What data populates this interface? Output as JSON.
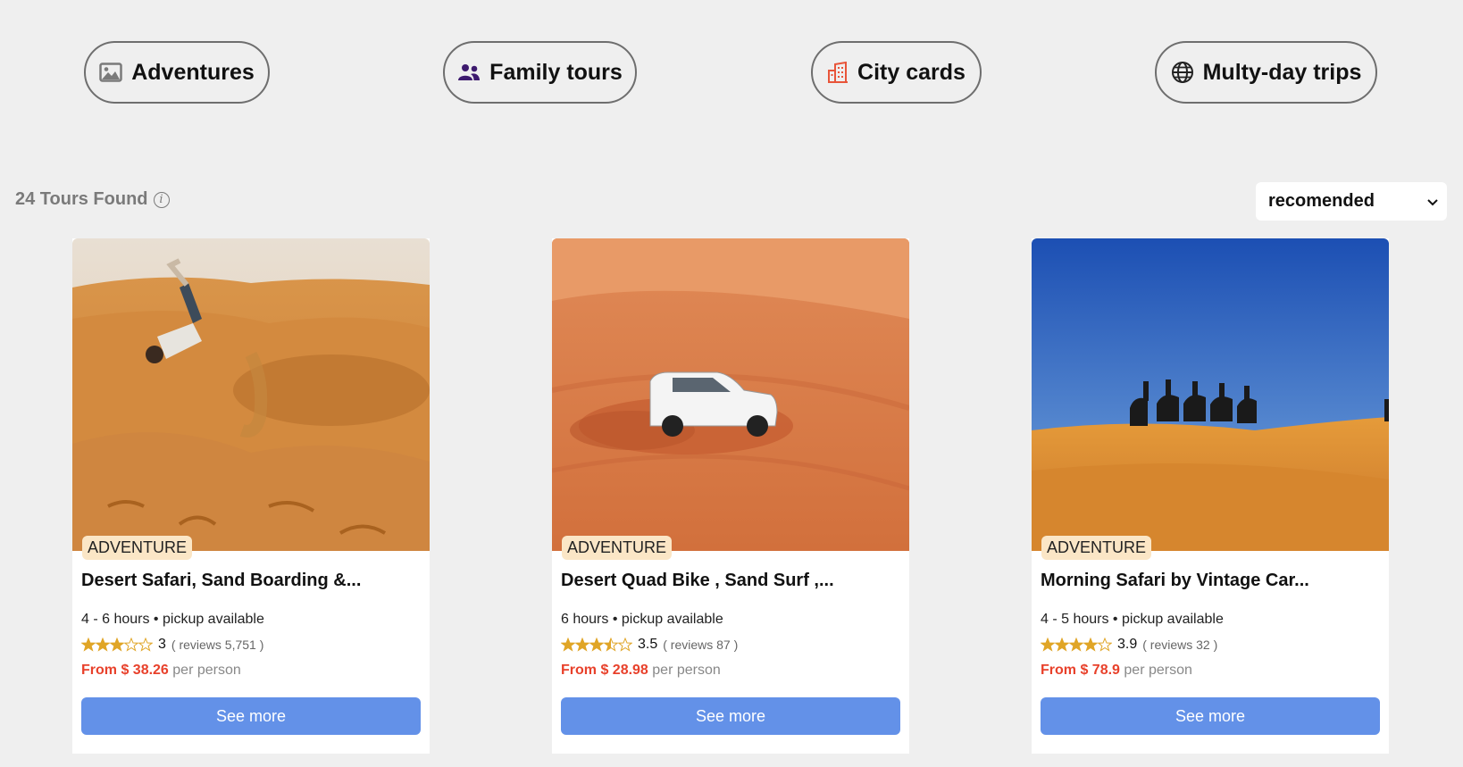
{
  "categories": [
    {
      "label": "Adventures",
      "icon": "image-icon"
    },
    {
      "label": "Family tours",
      "icon": "people-icon"
    },
    {
      "label": "City cards",
      "icon": "city-building-icon"
    },
    {
      "label": "Multy-day trips",
      "icon": "globe-icon"
    }
  ],
  "results": {
    "count_text": "24 Tours Found",
    "sort": {
      "selected": "recomended"
    }
  },
  "cards": [
    {
      "tag": "ADVENTURE",
      "title": "Desert Safari, Sand Boarding &...",
      "duration": "4 - 6 hours",
      "pickup": "pickup available",
      "rating": 3,
      "rating_text": "3",
      "reviews_text": "( reviews 5,751 )",
      "price_text": "From $ 38.26",
      "per_text": "per person",
      "button": "See more"
    },
    {
      "tag": "ADVENTURE",
      "title": "Desert Quad Bike , Sand Surf ,...",
      "duration": "6 hours",
      "pickup": "pickup available",
      "rating": 3.5,
      "rating_text": "3.5",
      "reviews_text": "( reviews 87 )",
      "price_text": "From $ 28.98",
      "per_text": "per person",
      "button": "See more"
    },
    {
      "tag": "ADVENTURE",
      "title": "Morning Safari by Vintage Car...",
      "duration": "4 - 5 hours",
      "pickup": "pickup available",
      "rating": 3.9,
      "rating_text": "3.9",
      "reviews_text": "( reviews 32 )",
      "price_text": "From $ 78.9",
      "per_text": "per person",
      "button": "See more"
    }
  ],
  "colors": {
    "background": "#efefef",
    "accent_button": "#6391e8",
    "price": "#e8412b",
    "star": "#e0a526",
    "tag_bg": "#fbe6c6"
  }
}
